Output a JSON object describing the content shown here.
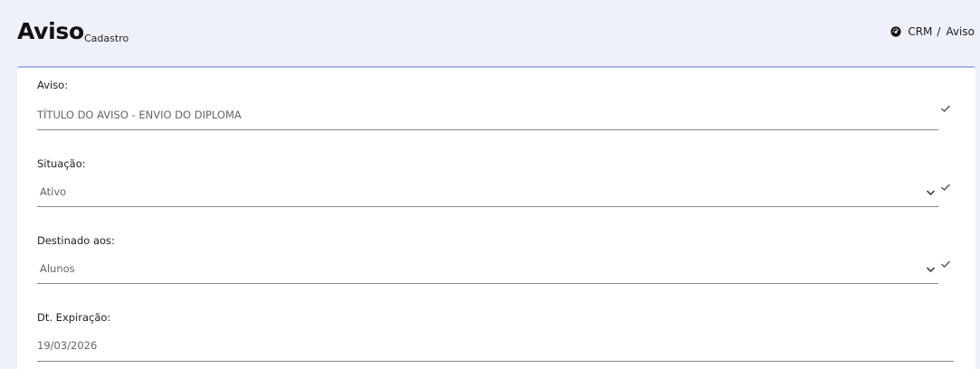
{
  "header": {
    "title": "Aviso",
    "subtitle": "Cadastro"
  },
  "breadcrumb": {
    "items": [
      "CRM",
      "Aviso"
    ],
    "separator": "/"
  },
  "form": {
    "aviso": {
      "label": "Aviso:",
      "value": "TÍTULO DO AVISO - ENVIO DO DIPLOMA"
    },
    "situacao": {
      "label": "Situação:",
      "value": "Ativo"
    },
    "destinado": {
      "label": "Destinado aos:",
      "value": "Alunos"
    },
    "expiracao": {
      "label": "Dt. Expiração:",
      "value": "19/03/2026"
    }
  },
  "colors": {
    "page_background": "#eef0fa",
    "card_accent": "#a9b3e6",
    "field_line": "#8a8a8a"
  }
}
